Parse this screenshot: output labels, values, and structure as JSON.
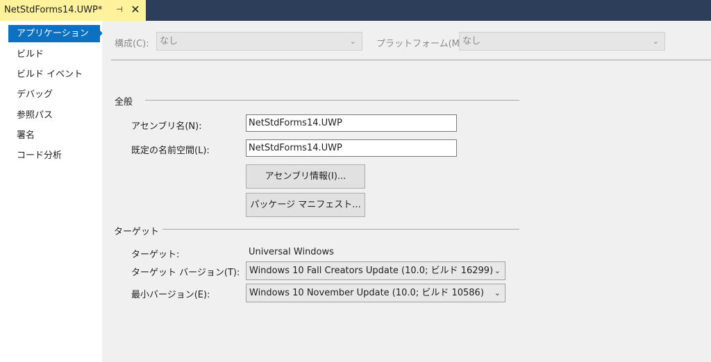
{
  "tab": {
    "title": "NetStdForms14.UWP*",
    "pin_glyph": "⊣",
    "close_glyph": "✕"
  },
  "sidebar": {
    "items": [
      {
        "label": "アプリケーション",
        "active": true
      },
      {
        "label": "ビルド"
      },
      {
        "label": "ビルド イベント"
      },
      {
        "label": "デバッグ"
      },
      {
        "label": "参照パス"
      },
      {
        "label": "署名"
      },
      {
        "label": "コード分析"
      }
    ]
  },
  "config_bar": {
    "configuration_label": "構成(C):",
    "configuration_value": "なし",
    "platform_label": "プラットフォーム(M):",
    "platform_value": "なし"
  },
  "general": {
    "heading": "全般",
    "assembly_name_label": "アセンブリ名(N):",
    "assembly_name_value": "NetStdForms14.UWP",
    "default_namespace_label": "既定の名前空間(L):",
    "default_namespace_value": "NetStdForms14.UWP",
    "assembly_info_button": "アセンブリ情報(I)...",
    "package_manifest_button": "パッケージ マニフェスト..."
  },
  "target": {
    "heading": "ターゲット",
    "target_label": "ターゲット:",
    "target_value": "Universal Windows",
    "target_version_label": "ターゲット バージョン(T):",
    "target_version_value": "Windows 10 Fall Creators Update (10.0; ビルド 16299)",
    "min_version_label": "最小バージョン(E):",
    "min_version_value": "Windows 10 November Update (10.0; ビルド 10586)"
  },
  "icons": {
    "chevron": "chevron-down-icon"
  }
}
